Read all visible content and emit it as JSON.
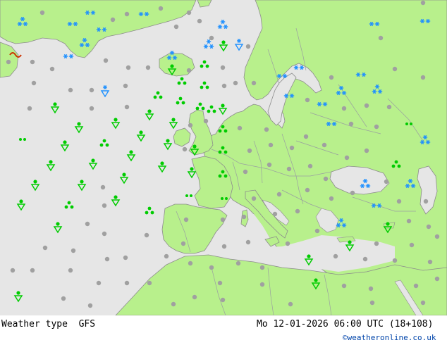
{
  "footer": {
    "left_label": "Weather type  GFS",
    "datetime": "Mo 12-01-2026 06:00 UTC (18+108)",
    "credit": "©weatheronline.co.uk"
  },
  "colors": {
    "sea": "#e6e6e6",
    "land": "#b8f08c",
    "border": "#9aa0a0",
    "coast": "#8c8c8c",
    "snow": "#1e90ff",
    "rain": "#00cc00",
    "cloud": "#a0a0a0"
  },
  "symbol_legend": {
    "snow-icon": "snow",
    "heavy-snow-icon": "snow showers",
    "rain-shower-icon": "rain showers",
    "drizzle-icon": "drizzle",
    "rain-icon": "rain",
    "cloudy-dot-icon": "cloudy / no precipitation"
  }
}
